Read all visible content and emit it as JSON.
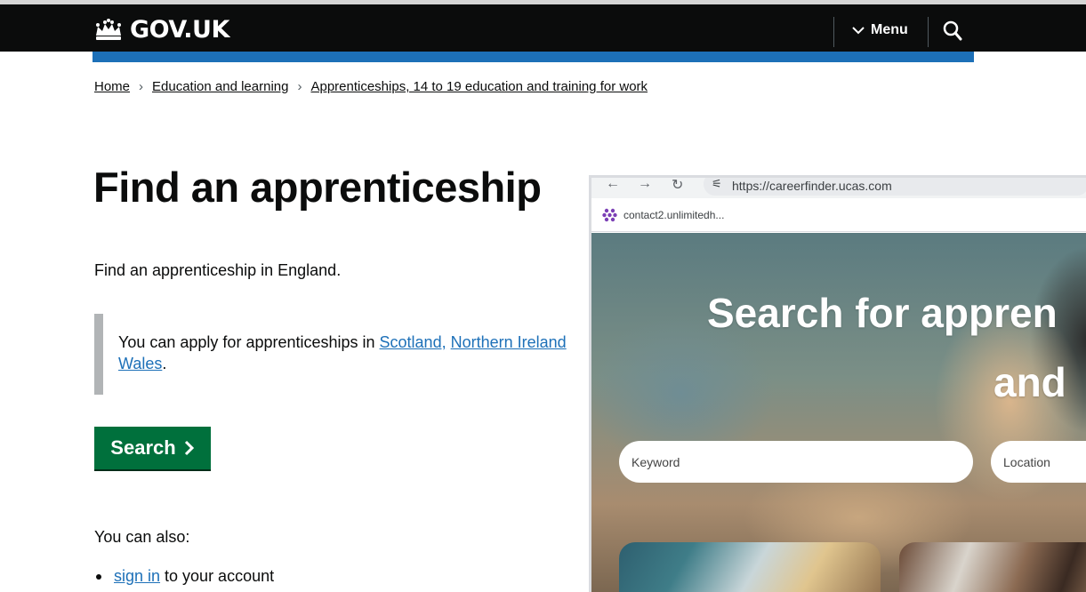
{
  "header": {
    "logo_text": "GOV.UK",
    "menu_label": "Menu",
    "brand_blue": "#1d70b8",
    "header_bg": "#0b0c0c"
  },
  "breadcrumb": {
    "items": [
      "Home",
      "Education and learning",
      "Apprenticeships, 14 to 19 education and training for work"
    ]
  },
  "main": {
    "title": "Find an apprenticeship",
    "lead": "Find an apprenticeship in England.",
    "inset": {
      "prefix": "You can apply for apprenticeships in ",
      "link_scotland": "Scotland,",
      "link_ni": "Northern Ireland",
      "link_wales": "Wales",
      "suffix": "."
    },
    "search_button": "Search",
    "button_color": "#00703c",
    "also_label": "You can also:",
    "list": [
      {
        "link": "sign in",
        "text": "to your account"
      }
    ]
  },
  "overlay": {
    "url": "https://careerfinder.ucas.com",
    "bookmark_label": "contact2.unlimitedh...",
    "hero_line1": "Search for appren",
    "hero_line2": "and",
    "keyword_placeholder": "Keyword",
    "location_placeholder": "Location",
    "icons": [
      "back-arrow-icon",
      "forward-arrow-icon",
      "reload-icon",
      "site-settings-icon",
      "bookmark-favicon-icon"
    ]
  }
}
